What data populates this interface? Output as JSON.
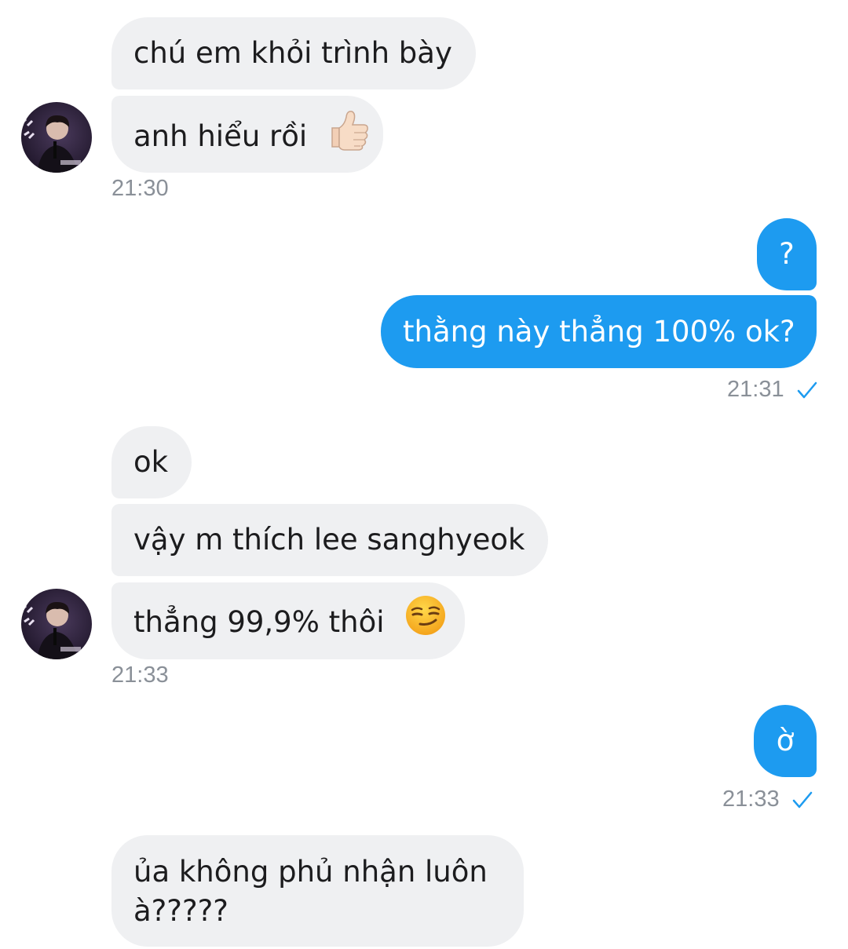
{
  "messages": {
    "m1": {
      "text": "chú em khỏi trình bày"
    },
    "m2": {
      "text": "anh hiểu rồi",
      "emoji": "thumbs-up-icon"
    },
    "t1": "21:30",
    "m3": {
      "text": "?"
    },
    "m4": {
      "text": "thằng này thẳng 100% ok?"
    },
    "t2": "21:31",
    "m5": {
      "text": "ok"
    },
    "m6": {
      "text": "vậy m thích lee sanghyeok"
    },
    "m7": {
      "text": "thẳng 99,9% thôi",
      "emoji": "smirking-face-icon"
    },
    "t3": "21:33",
    "m8": {
      "text": "ờ"
    },
    "t4": "21:33",
    "m9": {
      "line1": "ủa không phủ nhận luôn",
      "line2": "à?????"
    }
  },
  "colors": {
    "incoming_bubble": "#eff0f2",
    "outgoing_bubble": "#1d9bf0",
    "timestamp": "#8a9098",
    "read_check": "#1d9bf0"
  }
}
